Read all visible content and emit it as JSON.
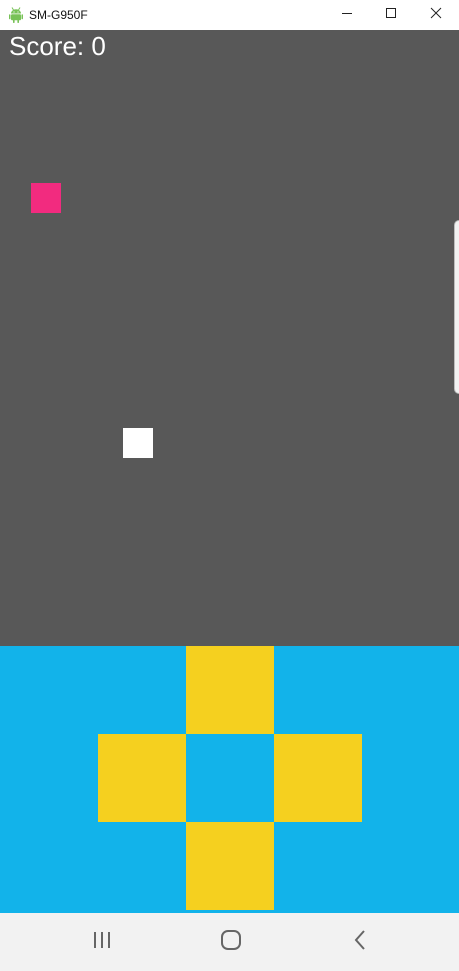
{
  "window": {
    "title": "SM-G950F",
    "icon": "android-icon"
  },
  "controls_icons": {
    "minimize": "minimize-icon",
    "maximize": "maximize-icon",
    "close": "close-icon"
  },
  "game": {
    "score_label": "Score: 0",
    "colors": {
      "field": "#585858",
      "food": "#f22b7f",
      "snake": "#ffffff",
      "controls_bg": "#12b3ea",
      "dpad": "#f5d01f"
    }
  },
  "dpad": {
    "up": "dpad-up-button",
    "left": "dpad-left-button",
    "right": "dpad-right-button",
    "down": "dpad-down-button"
  },
  "navbar": {
    "recent": "recent-apps-icon",
    "home": "home-icon",
    "back": "back-icon"
  }
}
